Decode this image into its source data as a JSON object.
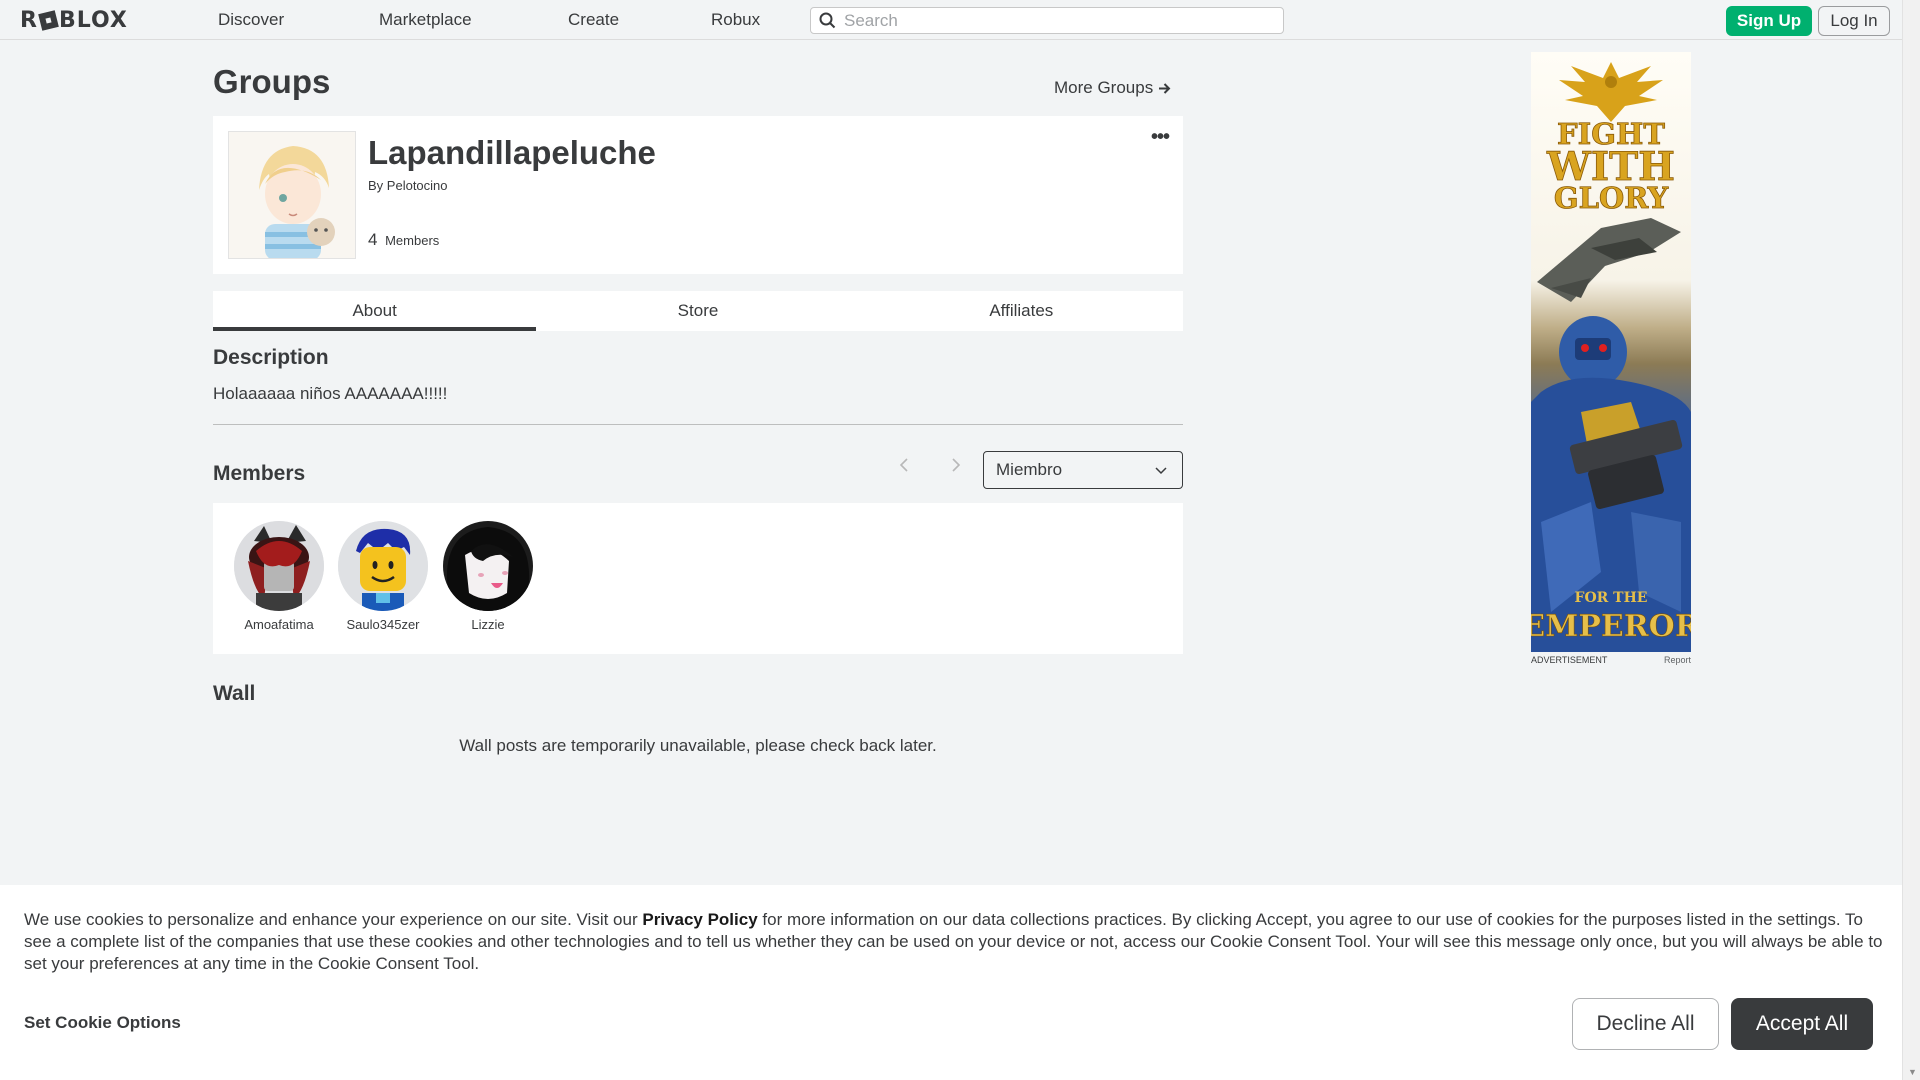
{
  "nav": {
    "logo": "ROBLOX",
    "links": [
      "Discover",
      "Marketplace",
      "Create",
      "Robux"
    ],
    "search_placeholder": "Search",
    "signup_label": "Sign Up",
    "login_label": "Log In"
  },
  "page": {
    "title": "Groups",
    "more_groups_label": "More Groups"
  },
  "group": {
    "name": "Lapandillapeluche",
    "by_prefix": "By",
    "owner": "Pelotocino",
    "member_count": "4",
    "member_count_label": "Members"
  },
  "tabs": [
    {
      "label": "About",
      "active": true
    },
    {
      "label": "Store",
      "active": false
    },
    {
      "label": "Affiliates",
      "active": false
    }
  ],
  "description": {
    "heading": "Description",
    "text": "Holaaaaaa niños AAAAAAA!!!!!"
  },
  "members": {
    "heading": "Members",
    "role_selected": "Miembro",
    "list": [
      {
        "name": "Amoafatima"
      },
      {
        "name": "Saulo345zer"
      },
      {
        "name": "Lizzie"
      }
    ]
  },
  "wall": {
    "heading": "Wall",
    "message": "Wall posts are temporarily unavailable, please check back later."
  },
  "ad": {
    "label": "ADVERTISEMENT",
    "report_label": "Report",
    "headline_line1": "FIGHT",
    "headline_line2": "WITH",
    "headline_line3": "GLORY",
    "tagline_small": "FOR THE",
    "tagline_big": "EMPEROR"
  },
  "cookie": {
    "text_before_link": "We use cookies to personalize and enhance your experience on our site. Visit our ",
    "link": "Privacy Policy",
    "text_after_link": " for more information on our data collections practices. By clicking Accept, you agree to our use of cookies for the purposes listed in the settings. To see a complete list of the companies that use these cookies and other technologies and to tell us whether they can be used on your device or not, access our Cookie Consent Tool. Your will see this message only once, but you will always be able to set your preferences at any time in the Cookie Consent Tool.",
    "options_label": "Set Cookie Options",
    "decline_label": "Decline All",
    "accept_label": "Accept All"
  },
  "colors": {
    "brand_green": "#00b06f",
    "text_dark": "#393b3d",
    "background": "#f2f4f5"
  }
}
